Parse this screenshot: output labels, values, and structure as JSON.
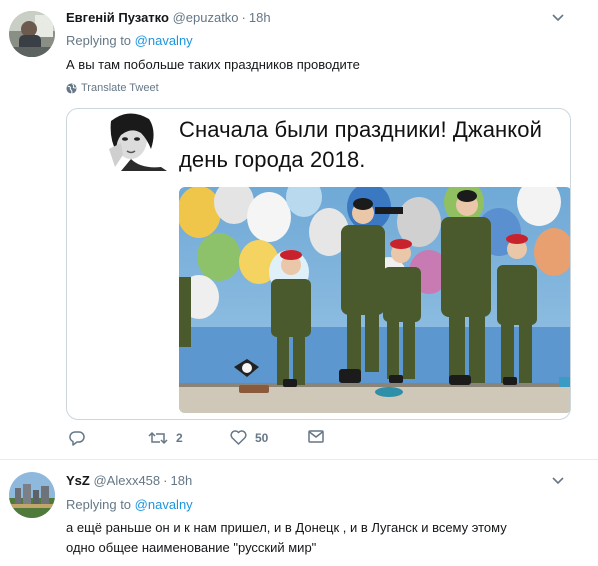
{
  "tweets": [
    {
      "name": "Евгеній Пузатко",
      "handle": "@epuzatko",
      "separator": "·",
      "time": "18h",
      "replying_prefix": "Replying to",
      "replying_mention": "@navalny",
      "text": "А вы там побольше таких праздников проводите",
      "translate_label": "Translate Tweet",
      "card": {
        "title_line1": "Сначала были праздники!  Джанкой",
        "title_line2": "день города 2018."
      },
      "actions": {
        "reply_count": "",
        "retweet_count": "2",
        "like_count": "50"
      }
    },
    {
      "name": "YsZ",
      "handle": "@Alexx458",
      "separator": "·",
      "time": "18h",
      "replying_prefix": "Replying to",
      "replying_mention": "@navalny",
      "text_line1": "а ещё раньше он и к нам пришел, и в Донецк , и в Луганск   и всему этому",
      "text_line2": "одно общее наименование  \"русский мир\""
    }
  ],
  "colors": {
    "link": "#1b95e0",
    "secondary": "#657786",
    "border": "#e6ecf0"
  },
  "icons": [
    "chevron-down-icon",
    "globe-icon",
    "reply-icon",
    "retweet-icon",
    "heart-icon",
    "mail-icon"
  ]
}
